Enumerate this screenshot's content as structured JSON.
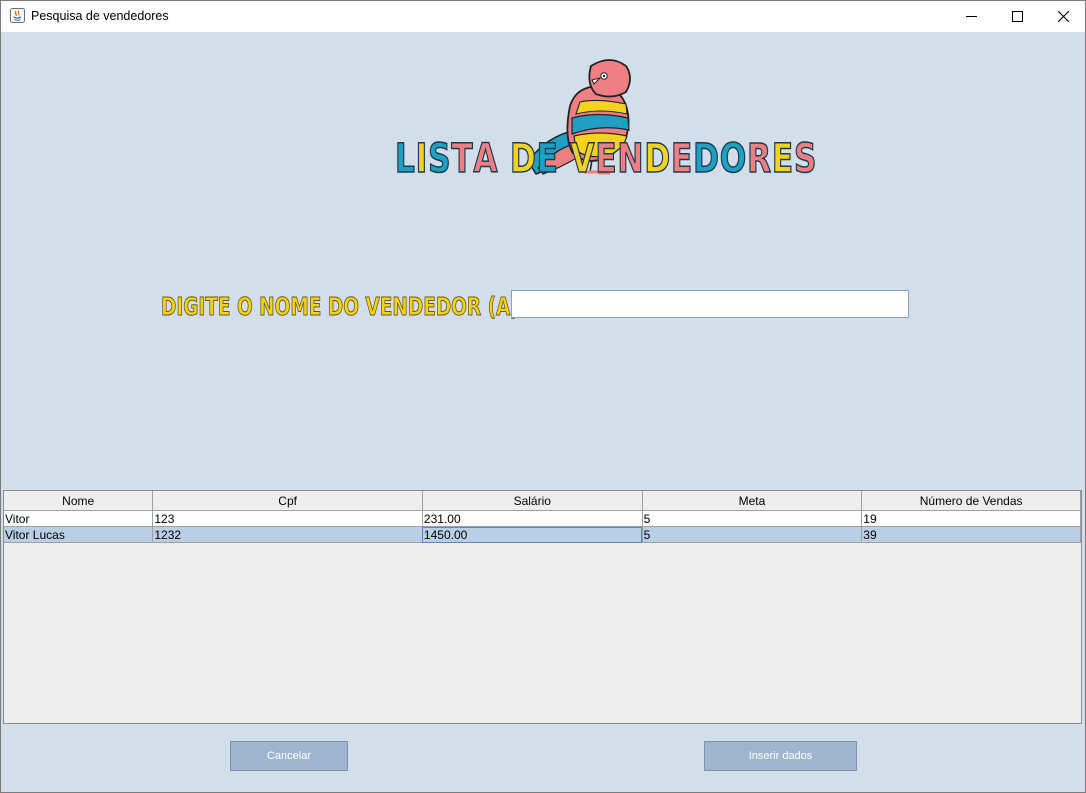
{
  "window": {
    "title": "Pesquisa de vendedores",
    "controls": {
      "minimize_icon": "minimize-icon",
      "maximize_icon": "maximize-icon",
      "close_icon": "close-icon"
    }
  },
  "header": {
    "logo_icon": "bird-logo",
    "logo_text": "LISTA DE VENDEDORES",
    "logo_colors": [
      "#f07f84",
      "#1f9fc4",
      "#f4d320"
    ]
  },
  "search": {
    "label": "DIGITE O NOME DO VENDEDOR (A):",
    "value": "",
    "placeholder": ""
  },
  "table": {
    "columns": [
      "Nome",
      "Cpf",
      "Salário",
      "Meta",
      "Número de Vendas"
    ],
    "rows": [
      [
        "Vitor",
        "123",
        "231.00",
        "5",
        "19"
      ],
      [
        "Vitor Lucas",
        "1232",
        "1450.00",
        "5",
        "39"
      ]
    ],
    "selected_row": 1,
    "focused_cell": [
      1,
      2
    ],
    "selection_color": "#b8cfe5"
  },
  "buttons": {
    "cancel_label": "Cancelar",
    "insert_label": "Inserir dados"
  },
  "colors": {
    "background": "#d2deea",
    "button_bg": "#9fb5cf",
    "label_yellow": "#f4d320"
  }
}
